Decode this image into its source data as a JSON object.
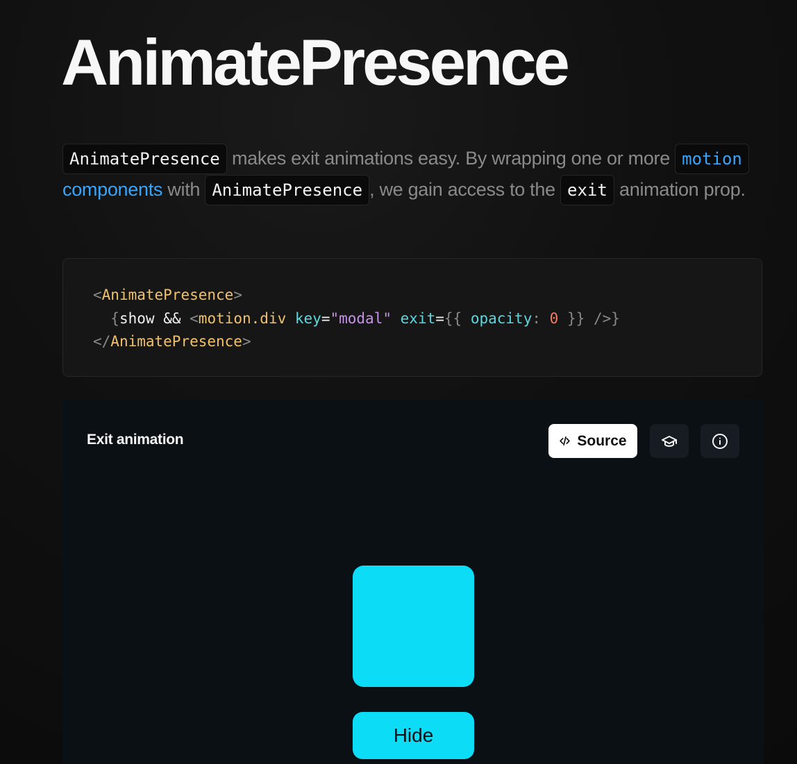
{
  "page": {
    "title": "AnimatePresence"
  },
  "intro": {
    "code1": "AnimatePresence",
    "text1": " makes exit animations easy. By wrapping one or more ",
    "code2": "motion",
    "link_text": "components",
    "text2": " with ",
    "code3": "AnimatePresence",
    "text3": ", we gain access to the ",
    "code4": "exit",
    "text4": "animation prop."
  },
  "code_sample": {
    "line1": {
      "open_bracket": "<",
      "tag": "AnimatePresence",
      "close_bracket": ">"
    },
    "line2": {
      "open_brace": "{",
      "show": "show",
      "and": "&&",
      "open_bracket": "<",
      "tag": "motion.div",
      "key_attr": "key",
      "eq1": "=",
      "key_value": "\"modal\"",
      "exit_attr": "exit",
      "eq2": "=",
      "open_braces": "{{",
      "opacity_key": "opacity",
      "colon": ":",
      "opacity_value": "0",
      "close_braces": "}}",
      "self_close": "/>",
      "close_brace": "}"
    },
    "line3": {
      "open_bracket": "</",
      "tag": "AnimatePresence",
      "close_bracket": ">"
    }
  },
  "demo": {
    "title": "Exit animation",
    "source_label": "Source",
    "box_color": "#0cdcf6",
    "hide_label": "Hide"
  },
  "icons": {
    "source": "code-icon",
    "learn": "graduation-cap-icon",
    "info": "info-icon"
  }
}
